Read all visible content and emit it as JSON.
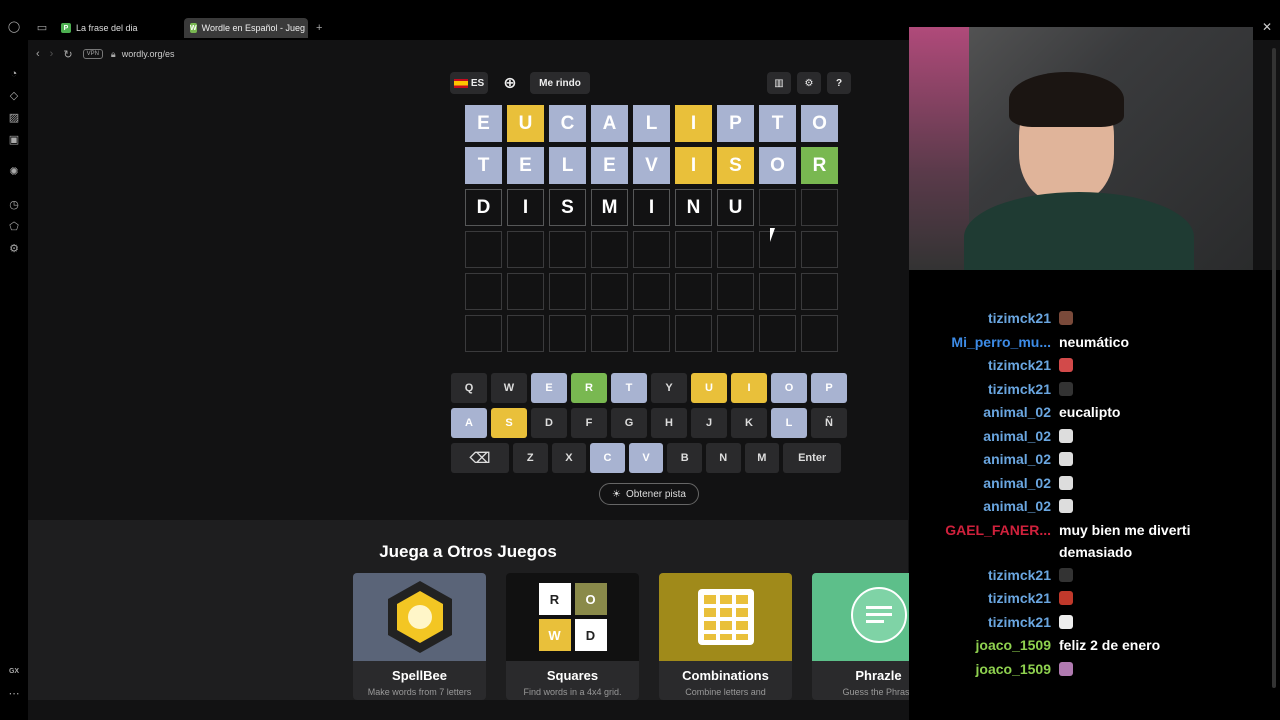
{
  "browser": {
    "tabs": [
      {
        "label": "La frase del dia",
        "favicon": "P"
      },
      {
        "label": "Wordle en Español - Jueg",
        "favicon": "W"
      }
    ],
    "new_tab": "+",
    "vpn": "VPN",
    "url": "wordly.org/es",
    "sidebar_footer": "GX"
  },
  "game": {
    "lang": "ES",
    "give_up": "Me rindo",
    "rows": [
      [
        [
          "E",
          "absent"
        ],
        [
          "U",
          "present"
        ],
        [
          "C",
          "absent"
        ],
        [
          "A",
          "absent"
        ],
        [
          "L",
          "absent"
        ],
        [
          "I",
          "present"
        ],
        [
          "P",
          "absent"
        ],
        [
          "T",
          "absent"
        ],
        [
          "O",
          "absent"
        ]
      ],
      [
        [
          "T",
          "absent"
        ],
        [
          "E",
          "absent"
        ],
        [
          "L",
          "absent"
        ],
        [
          "E",
          "absent"
        ],
        [
          "V",
          "absent"
        ],
        [
          "I",
          "present"
        ],
        [
          "S",
          "present"
        ],
        [
          "O",
          "absent"
        ],
        [
          "R",
          "correct"
        ]
      ],
      [
        [
          "D",
          "typed"
        ],
        [
          "I",
          "typed"
        ],
        [
          "S",
          "typed"
        ],
        [
          "M",
          "typed"
        ],
        [
          "I",
          "typed"
        ],
        [
          "N",
          "typed"
        ],
        [
          "U",
          "typed"
        ],
        [
          "",
          "empty"
        ],
        [
          "",
          "empty"
        ]
      ],
      [
        [
          "",
          "empty"
        ],
        [
          "",
          "empty"
        ],
        [
          "",
          "empty"
        ],
        [
          "",
          "empty"
        ],
        [
          "",
          "empty"
        ],
        [
          "",
          "empty"
        ],
        [
          "",
          "empty"
        ],
        [
          "",
          "empty"
        ],
        [
          "",
          "empty"
        ]
      ],
      [
        [
          "",
          "empty"
        ],
        [
          "",
          "empty"
        ],
        [
          "",
          "empty"
        ],
        [
          "",
          "empty"
        ],
        [
          "",
          "empty"
        ],
        [
          "",
          "empty"
        ],
        [
          "",
          "empty"
        ],
        [
          "",
          "empty"
        ],
        [
          "",
          "empty"
        ]
      ],
      [
        [
          "",
          "empty"
        ],
        [
          "",
          "empty"
        ],
        [
          "",
          "empty"
        ],
        [
          "",
          "empty"
        ],
        [
          "",
          "empty"
        ],
        [
          "",
          "empty"
        ],
        [
          "",
          "empty"
        ],
        [
          "",
          "empty"
        ],
        [
          "",
          "empty"
        ]
      ]
    ],
    "keyboard": [
      [
        [
          "Q",
          ""
        ],
        [
          "W",
          ""
        ],
        [
          "E",
          "absent"
        ],
        [
          "R",
          "correct"
        ],
        [
          "T",
          "absent"
        ],
        [
          "Y",
          ""
        ],
        [
          "U",
          "present"
        ],
        [
          "I",
          "present"
        ],
        [
          "O",
          "absent"
        ],
        [
          "P",
          "absent"
        ]
      ],
      [
        [
          "A",
          "absent"
        ],
        [
          "S",
          "present"
        ],
        [
          "D",
          ""
        ],
        [
          "F",
          ""
        ],
        [
          "G",
          ""
        ],
        [
          "H",
          ""
        ],
        [
          "J",
          ""
        ],
        [
          "K",
          ""
        ],
        [
          "L",
          "absent"
        ],
        [
          "Ñ",
          ""
        ]
      ],
      [
        [
          "⌫",
          ""
        ],
        [
          "Z",
          ""
        ],
        [
          "X",
          ""
        ],
        [
          "C",
          "absent"
        ],
        [
          "V",
          "absent"
        ],
        [
          "B",
          ""
        ],
        [
          "N",
          ""
        ],
        [
          "M",
          ""
        ],
        [
          "Enter",
          ""
        ]
      ]
    ],
    "hint_label": "Obtener pista"
  },
  "other_games": {
    "title": "Juega a Otros Juegos",
    "cards": [
      {
        "name": "SpellBee",
        "desc": "Make words from 7 letters",
        "color": "#5a6478"
      },
      {
        "name": "Squares",
        "desc": "Find words in a 4x4 grid.",
        "color": "#111111",
        "tiles": [
          "R",
          "O",
          "W",
          "D"
        ]
      },
      {
        "name": "Combinations",
        "desc": "Combine letters and",
        "color": "#a08a1a"
      },
      {
        "name": "Phrazle",
        "desc": "Guess the Phrase",
        "color": "#5dbf8a"
      }
    ]
  },
  "chat": [
    {
      "user": "tizimck21",
      "color": "#6aa6e0",
      "text": "",
      "emote": "#7a4a3a"
    },
    {
      "user": "Mi_perro_mu...",
      "color": "#3d8be6",
      "text": "neumático",
      "emote": ""
    },
    {
      "user": "tizimck21",
      "color": "#6aa6e0",
      "text": "",
      "emote": "#d24a4a"
    },
    {
      "user": "tizimck21",
      "color": "#6aa6e0",
      "text": "",
      "emote": "#333333"
    },
    {
      "user": "animal_02",
      "color": "#6aa6e0",
      "text": "eucalipto",
      "emote": ""
    },
    {
      "user": "animal_02",
      "color": "#6aa6e0",
      "text": "",
      "emote": "#dddddd"
    },
    {
      "user": "animal_02",
      "color": "#6aa6e0",
      "text": "",
      "emote": "#dddddd"
    },
    {
      "user": "animal_02",
      "color": "#6aa6e0",
      "text": "",
      "emote": "#dddddd"
    },
    {
      "user": "animal_02",
      "color": "#6aa6e0",
      "text": "",
      "emote": "#dddddd"
    },
    {
      "user": "GAEL_FANER...",
      "color": "#d0213c",
      "text": "muy bien me diverti demasiado",
      "emote": ""
    },
    {
      "user": "tizimck21",
      "color": "#6aa6e0",
      "text": "",
      "emote": "#333333"
    },
    {
      "user": "tizimck21",
      "color": "#6aa6e0",
      "text": "",
      "emote": "#c0392b"
    },
    {
      "user": "tizimck21",
      "color": "#6aa6e0",
      "text": "",
      "emote": "#eeeeee"
    },
    {
      "user": "joaco_1509",
      "color": "#8fd14f",
      "text": "feliz 2 de enero",
      "emote": ""
    },
    {
      "user": "joaco_1509",
      "color": "#8fd14f",
      "text": "",
      "emote": "#b07ab0"
    }
  ]
}
